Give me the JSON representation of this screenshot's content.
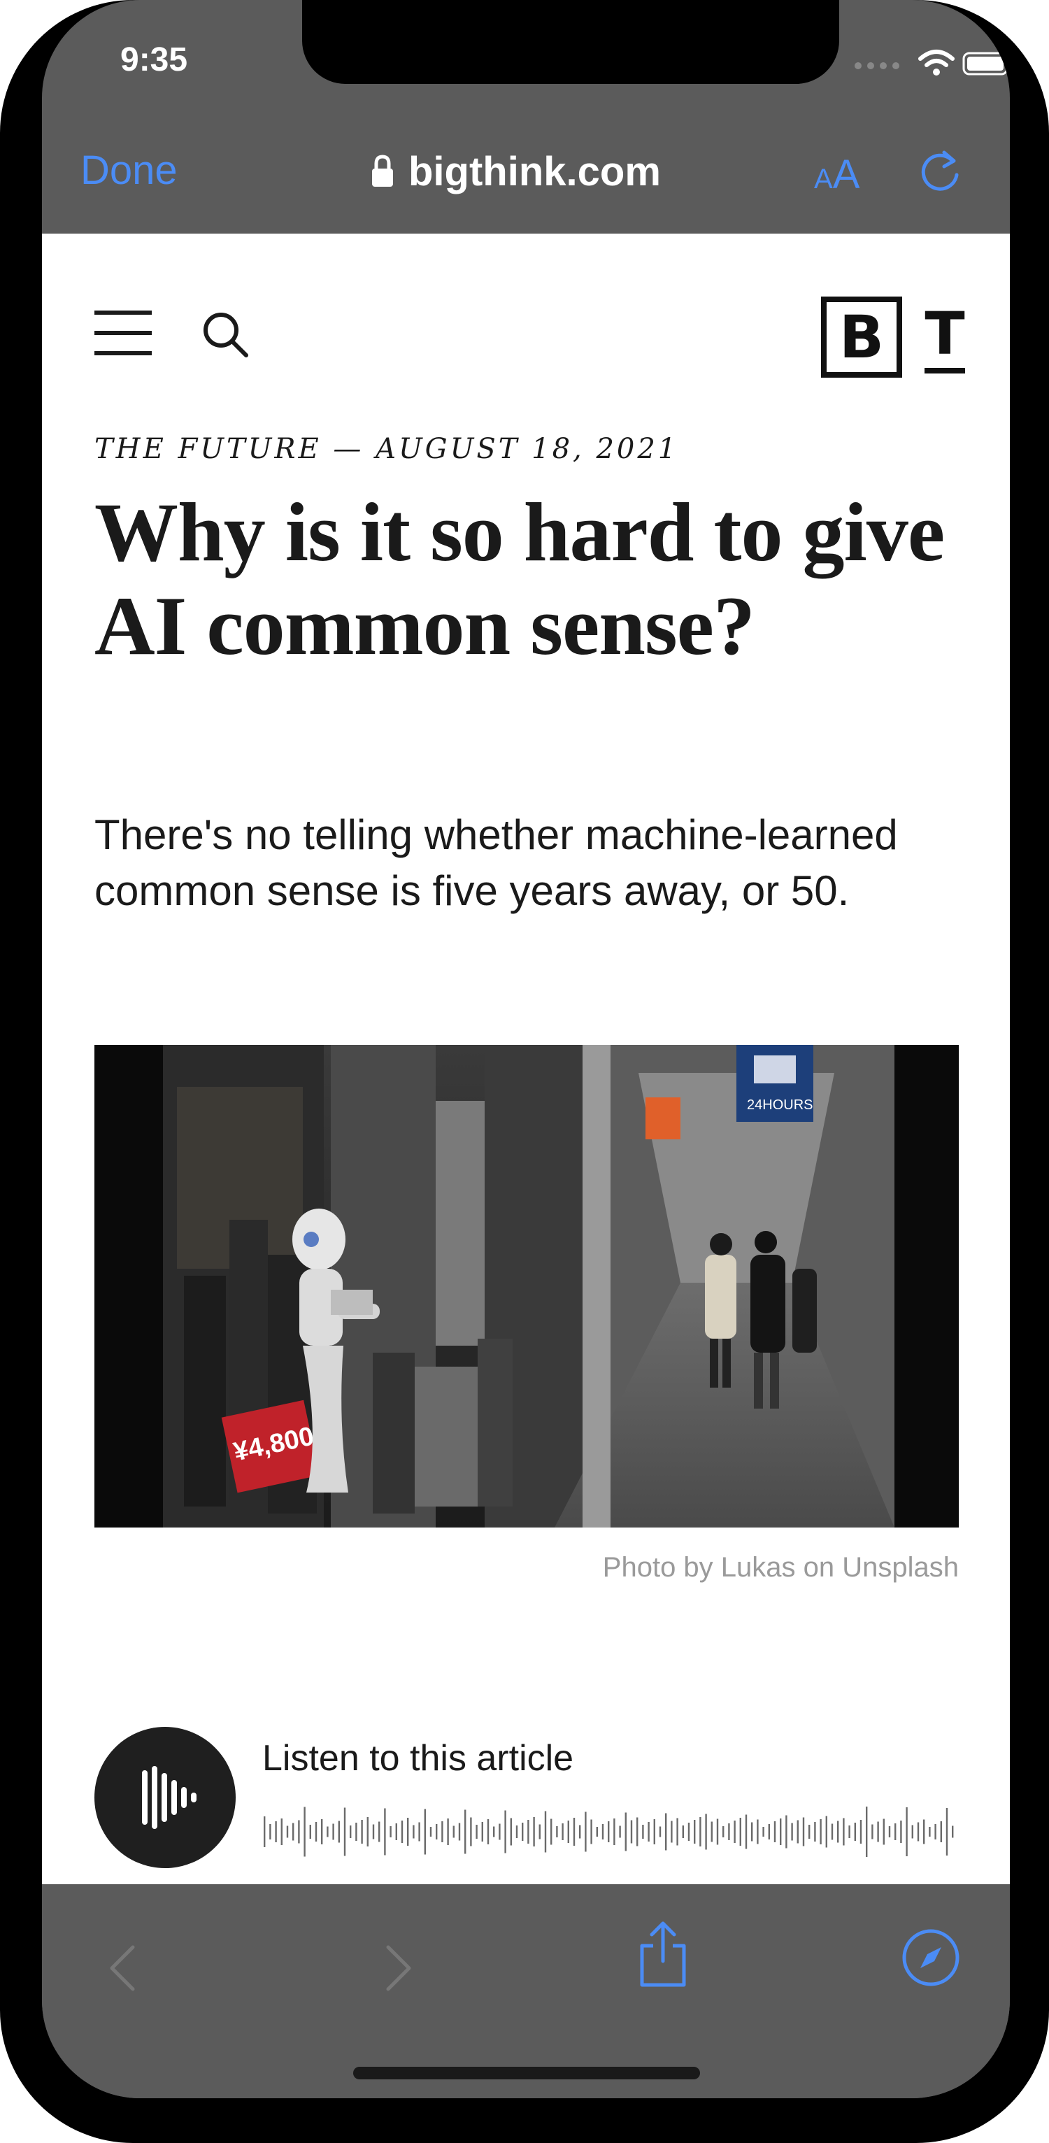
{
  "status_bar": {
    "time": "9:35"
  },
  "browser": {
    "done_label": "Done",
    "url": "bigthink.com",
    "text_size_small": "A",
    "text_size_large": "A"
  },
  "site": {
    "logo_b": "B",
    "logo_t": "T"
  },
  "article": {
    "kicker": "THE FUTURE — AUGUST 18, 2021",
    "headline": "Why is it so hard to give AI common sense?",
    "dek": "There's no telling whether machine-learned common sense is five years away, or 50.",
    "photo_sign": "¥4,800",
    "photo_sign2": "24HOURS",
    "photo_credit": "Photo by Lukas on Unsplash"
  },
  "audio": {
    "label": "Listen to this article"
  },
  "colors": {
    "accent": "#4b8cf5",
    "chrome": "#5b5b5b",
    "text": "#1a1a1a"
  },
  "icons": {
    "menu": "hamburger-icon",
    "search": "search-icon",
    "lock": "lock-icon",
    "reload": "reload-icon",
    "back": "chevron-left-icon",
    "forward": "chevron-right-icon",
    "share": "share-icon",
    "compass": "compass-icon",
    "audio": "audio-waveform-icon"
  }
}
